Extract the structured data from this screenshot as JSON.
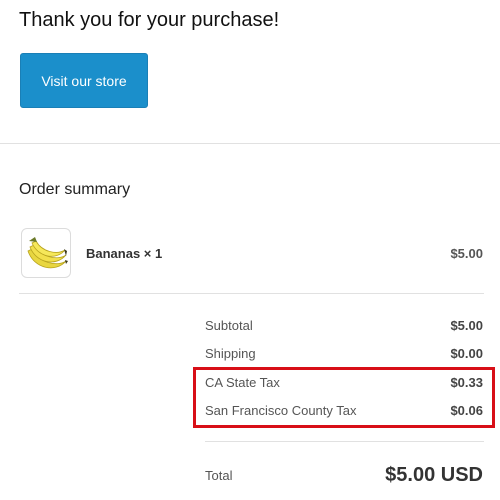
{
  "header": {
    "title": "Thank you for your purchase!",
    "store_button_label": "Visit our store"
  },
  "summary": {
    "heading": "Order summary",
    "items": [
      {
        "name": "Bananas × 1",
        "price": "$5.00",
        "image_icon": "bananas-image"
      }
    ],
    "costs": {
      "subtotal": {
        "label": "Subtotal",
        "value": "$5.00"
      },
      "shipping": {
        "label": "Shipping",
        "value": "$0.00"
      },
      "ca_tax": {
        "label": "CA State Tax",
        "value": "$0.33"
      },
      "county_tax": {
        "label": "San Francisco County Tax",
        "value": "$0.06"
      }
    },
    "total": {
      "label": "Total",
      "value": "$5.00 USD"
    }
  },
  "colors": {
    "button": "#1b8fcb",
    "highlight": "#d80f17"
  }
}
